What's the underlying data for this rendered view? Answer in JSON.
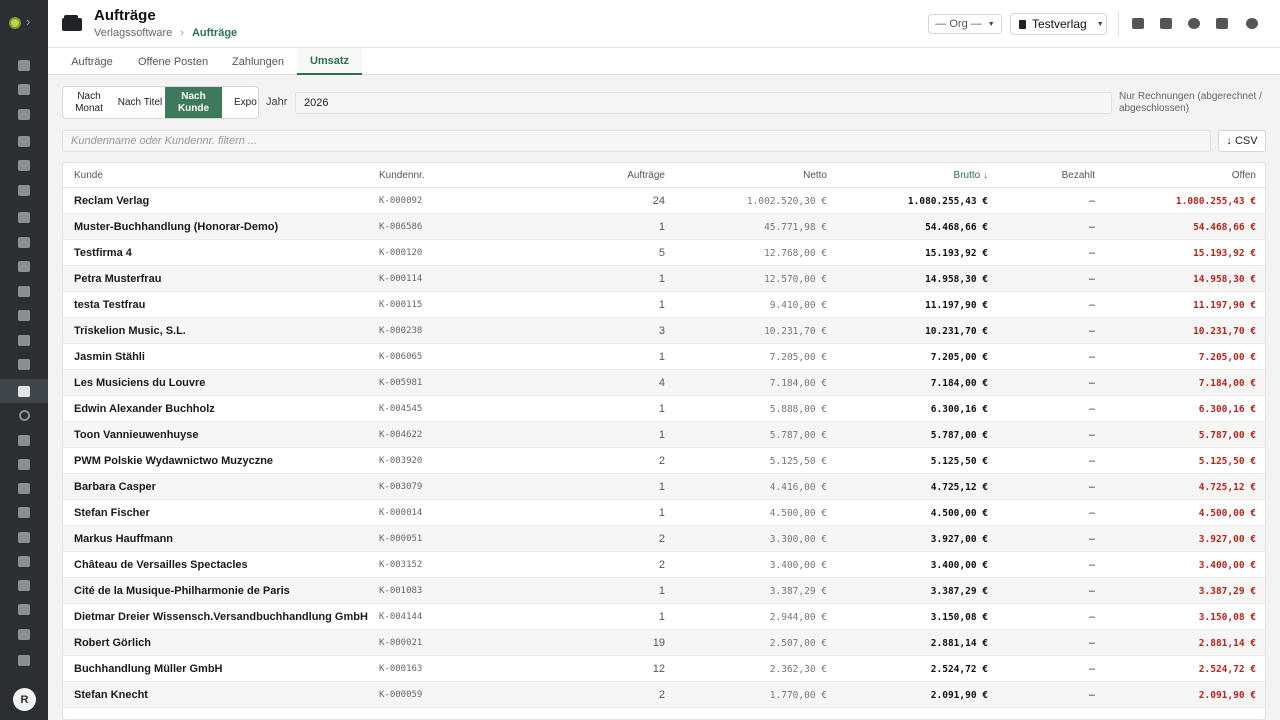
{
  "app": {
    "title": "Aufträge",
    "breadcrumb": [
      "Verlagssoftware",
      "Aufträge"
    ],
    "org_select": "— Org —",
    "publisher_select": "Testverlag",
    "avatar_initial": "R"
  },
  "tabs": [
    "Aufträge",
    "Offene Posten",
    "Zahlungen",
    "Umsatz"
  ],
  "active_tab": "Umsatz",
  "group_by": {
    "options": [
      "Nach Monat",
      "Nach Titel",
      "Nach Kunde",
      "Expo"
    ],
    "selected": "Nach Kunde"
  },
  "year": {
    "label": "Jahr",
    "value": "2026"
  },
  "note": "Nur Rechnungen (abgerechnet / abgeschlossen)",
  "filter": {
    "placeholder": "Kundenname oder Kundennr. filtern ..."
  },
  "csv_button": "↓ CSV",
  "table": {
    "columns": [
      "Kunde",
      "Kundennr.",
      "Aufträge",
      "Netto",
      "Brutto ↓",
      "Bezahlt",
      "Offen"
    ],
    "sorted_column": "Brutto",
    "rows": [
      {
        "kunde": "Reclam Verlag",
        "nr": "K-000092",
        "auftraege": "24",
        "netto": "1.002.520,30 €",
        "brutto": "1.080.255,43 €",
        "bezahlt": "–",
        "offen": "1.080.255,43 €"
      },
      {
        "kunde": "Muster-Buchhandlung (Honorar-Demo)",
        "nr": "K-006586",
        "auftraege": "1",
        "netto": "45.771,98 €",
        "brutto": "54.468,66 €",
        "bezahlt": "–",
        "offen": "54.468,66 €"
      },
      {
        "kunde": "Testfirma 4",
        "nr": "K-000120",
        "auftraege": "5",
        "netto": "12.768,00 €",
        "brutto": "15.193,92 €",
        "bezahlt": "–",
        "offen": "15.193,92 €"
      },
      {
        "kunde": "Petra Musterfrau",
        "nr": "K-000114",
        "auftraege": "1",
        "netto": "12.570,00 €",
        "brutto": "14.958,30 €",
        "bezahlt": "–",
        "offen": "14.958,30 €"
      },
      {
        "kunde": "testa Testfrau",
        "nr": "K-000115",
        "auftraege": "1",
        "netto": "9.410,00 €",
        "brutto": "11.197,90 €",
        "bezahlt": "–",
        "offen": "11.197,90 €"
      },
      {
        "kunde": "Triskelion Music, S.L.",
        "nr": "K-000238",
        "auftraege": "3",
        "netto": "10.231,70 €",
        "brutto": "10.231,70 €",
        "bezahlt": "–",
        "offen": "10.231,70 €"
      },
      {
        "kunde": "Jasmin Stähli",
        "nr": "K-006065",
        "auftraege": "1",
        "netto": "7.205,00 €",
        "brutto": "7.205,00 €",
        "bezahlt": "–",
        "offen": "7.205,00 €"
      },
      {
        "kunde": "Les Musiciens du Louvre",
        "nr": "K-005981",
        "auftraege": "4",
        "netto": "7.184,00 €",
        "brutto": "7.184,00 €",
        "bezahlt": "–",
        "offen": "7.184,00 €"
      },
      {
        "kunde": "Edwin Alexander Buchholz",
        "nr": "K-004545",
        "auftraege": "1",
        "netto": "5.888,00 €",
        "brutto": "6.300,16 €",
        "bezahlt": "–",
        "offen": "6.300,16 €"
      },
      {
        "kunde": "Toon Vannieuwenhuyse",
        "nr": "K-004622",
        "auftraege": "1",
        "netto": "5.787,00 €",
        "brutto": "5.787,00 €",
        "bezahlt": "–",
        "offen": "5.787,00 €"
      },
      {
        "kunde": "PWM Polskie Wydawnictwo Muzyczne",
        "nr": "K-003920",
        "auftraege": "2",
        "netto": "5.125,50 €",
        "brutto": "5.125,50 €",
        "bezahlt": "–",
        "offen": "5.125,50 €"
      },
      {
        "kunde": "Barbara Casper",
        "nr": "K-003079",
        "auftraege": "1",
        "netto": "4.416,00 €",
        "brutto": "4.725,12 €",
        "bezahlt": "–",
        "offen": "4.725,12 €"
      },
      {
        "kunde": "Stefan Fischer",
        "nr": "K-000014",
        "auftraege": "1",
        "netto": "4.500,00 €",
        "brutto": "4.500,00 €",
        "bezahlt": "–",
        "offen": "4.500,00 €"
      },
      {
        "kunde": "Markus Hauffmann",
        "nr": "K-000051",
        "auftraege": "2",
        "netto": "3.300,00 €",
        "brutto": "3.927,00 €",
        "bezahlt": "–",
        "offen": "3.927,00 €"
      },
      {
        "kunde": "Château de Versailles Spectacles",
        "nr": "K-003152",
        "auftraege": "2",
        "netto": "3.400,00 €",
        "brutto": "3.400,00 €",
        "bezahlt": "–",
        "offen": "3.400,00 €"
      },
      {
        "kunde": "Cité de la Musique-Philharmonie de Paris",
        "nr": "K-001083",
        "auftraege": "1",
        "netto": "3.387,29 €",
        "brutto": "3.387,29 €",
        "bezahlt": "–",
        "offen": "3.387,29 €"
      },
      {
        "kunde": "Dietmar Dreier Wissensch.Versandbuchhandlung GmbH",
        "nr": "K-004144",
        "auftraege": "1",
        "netto": "2.944,00 €",
        "brutto": "3.150,08 €",
        "bezahlt": "–",
        "offen": "3.150,08 €"
      },
      {
        "kunde": "Robert Görlich",
        "nr": "K-000021",
        "auftraege": "19",
        "netto": "2.507,00 €",
        "brutto": "2.881,14 €",
        "bezahlt": "–",
        "offen": "2.881,14 €"
      },
      {
        "kunde": "Buchhandlung Müller GmbH",
        "nr": "K-000163",
        "auftraege": "12",
        "netto": "2.362,30 €",
        "brutto": "2.524,72 €",
        "bezahlt": "–",
        "offen": "2.524,72 €"
      },
      {
        "kunde": "Stefan Knecht",
        "nr": "K-000059",
        "auftraege": "2",
        "netto": "1.770,00 €",
        "brutto": "2.091,90 €",
        "bezahlt": "–",
        "offen": "2.091,90 €"
      }
    ]
  },
  "sidebar_icons": [
    "dashboard-icon",
    "calendar-icon",
    "layout-icon",
    "user-edit-icon",
    "mail-icon",
    "send-icon",
    "idea-icon",
    "library-icon",
    "image-icon",
    "briefcase-icon",
    "news-icon",
    "receipt-icon",
    "feather-icon",
    "orders-icon",
    "circle-icon",
    "bag-icon",
    "megaphone-icon",
    "truck-icon",
    "music-icon",
    "file-icon",
    "store-icon",
    "shipping-icon",
    "chart-icon",
    "document-icon",
    "shield-icon"
  ],
  "active_sidebar_icon": "orders-icon",
  "header_icons": [
    "download-icon",
    "chat-icon",
    "signal-icon",
    "users-icon",
    "moon-icon"
  ]
}
